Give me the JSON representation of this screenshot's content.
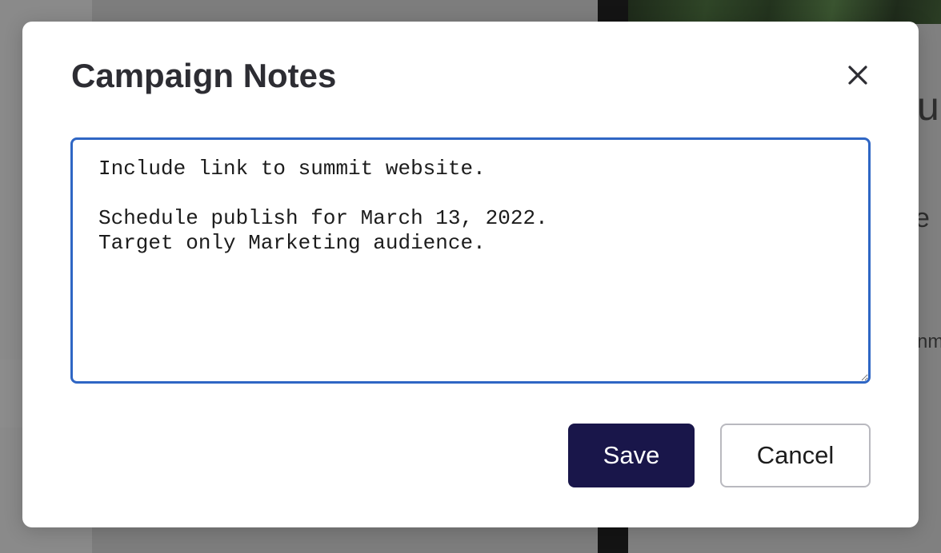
{
  "background_page": {
    "fragment_1": "ur",
    "fragment_2": "e",
    "fragment_3": "nm"
  },
  "modal": {
    "title": "Campaign Notes",
    "close_icon": "close-icon",
    "notes": {
      "value": "Include link to summit website.\n\nSchedule publish for March 13, 2022.\nTarget only Marketing audience."
    },
    "save_label": "Save",
    "cancel_label": "Cancel"
  },
  "colors": {
    "primary_button": "#19164a",
    "focus_border": "#2f66c4",
    "title_text": "#2d2d33"
  }
}
